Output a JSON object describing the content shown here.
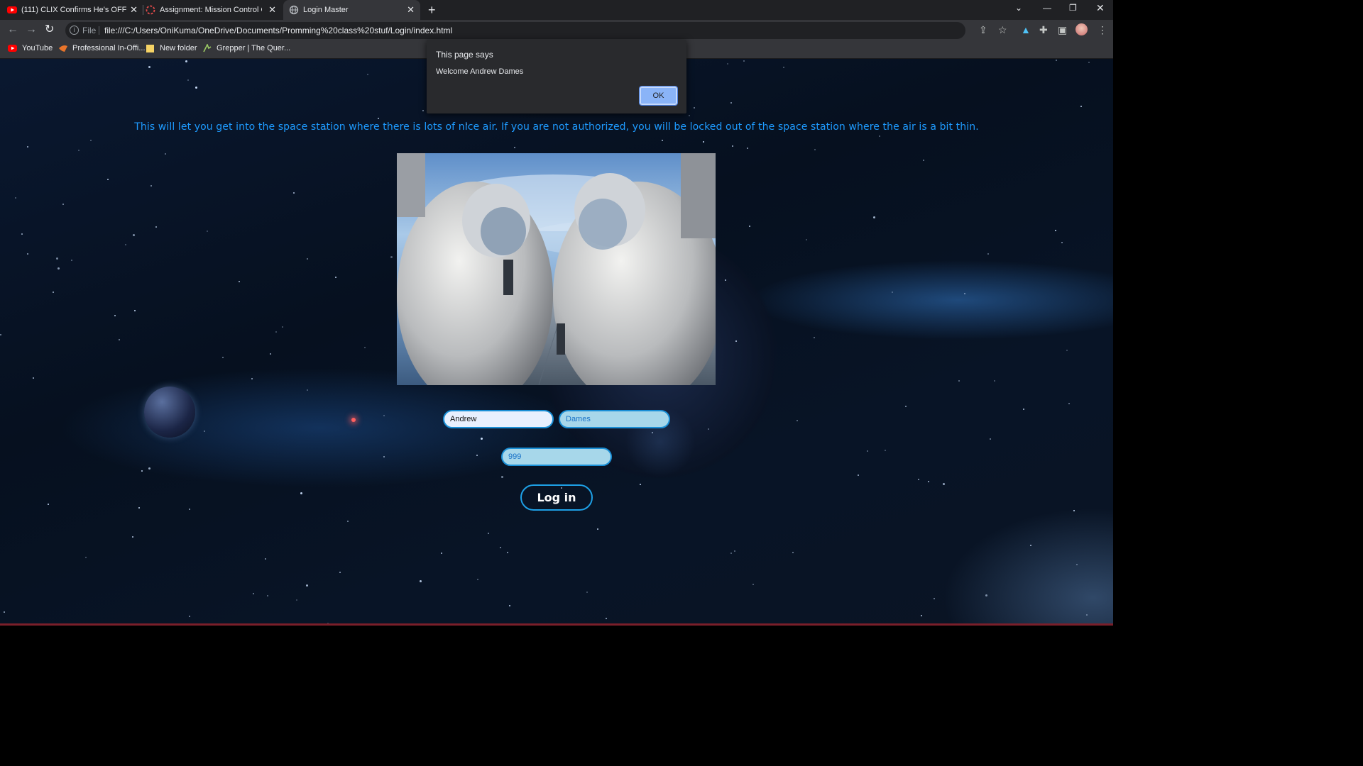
{
  "browser": {
    "tabs": [
      {
        "title": "(111) CLIX Confirms He's OFFICIA",
        "icon": "youtube-icon",
        "active": false
      },
      {
        "title": "Assignment: Mission Control Op",
        "icon": "loading-icon",
        "active": false
      },
      {
        "title": "Login Master",
        "icon": "globe-icon",
        "active": true
      }
    ],
    "new_tab": "+",
    "address": {
      "scheme": "File",
      "url": "file:///C:/Users/OniKuma/OneDrive/Documents/Promming%20class%20stuf/Login/index.html"
    },
    "bookmarks": [
      {
        "label": "YouTube",
        "icon": "youtube-icon"
      },
      {
        "label": "Professional In-Offi...",
        "icon": "bookmark-icon"
      },
      {
        "label": "New folder",
        "icon": "folder-icon"
      },
      {
        "label": "Grepper | The Quer...",
        "icon": "grepper-icon"
      }
    ]
  },
  "page": {
    "intro": "This will let you get into the space station where there is lots of nice air. If you are not authorized, you will be locked out of the space station where the air is a bit thin.",
    "image": {
      "subject": "astronauts"
    },
    "form": {
      "first_name": "Andrew",
      "last_name": "Dames",
      "code": "999",
      "login_label": "Log in"
    }
  },
  "dialog": {
    "title": "This page says",
    "message": "Welcome Andrew Dames",
    "ok_label": "OK"
  },
  "colors": {
    "accent": "#1e9bff",
    "dialog_bg": "#292a2d",
    "ok_button": "#8ab4f8"
  }
}
